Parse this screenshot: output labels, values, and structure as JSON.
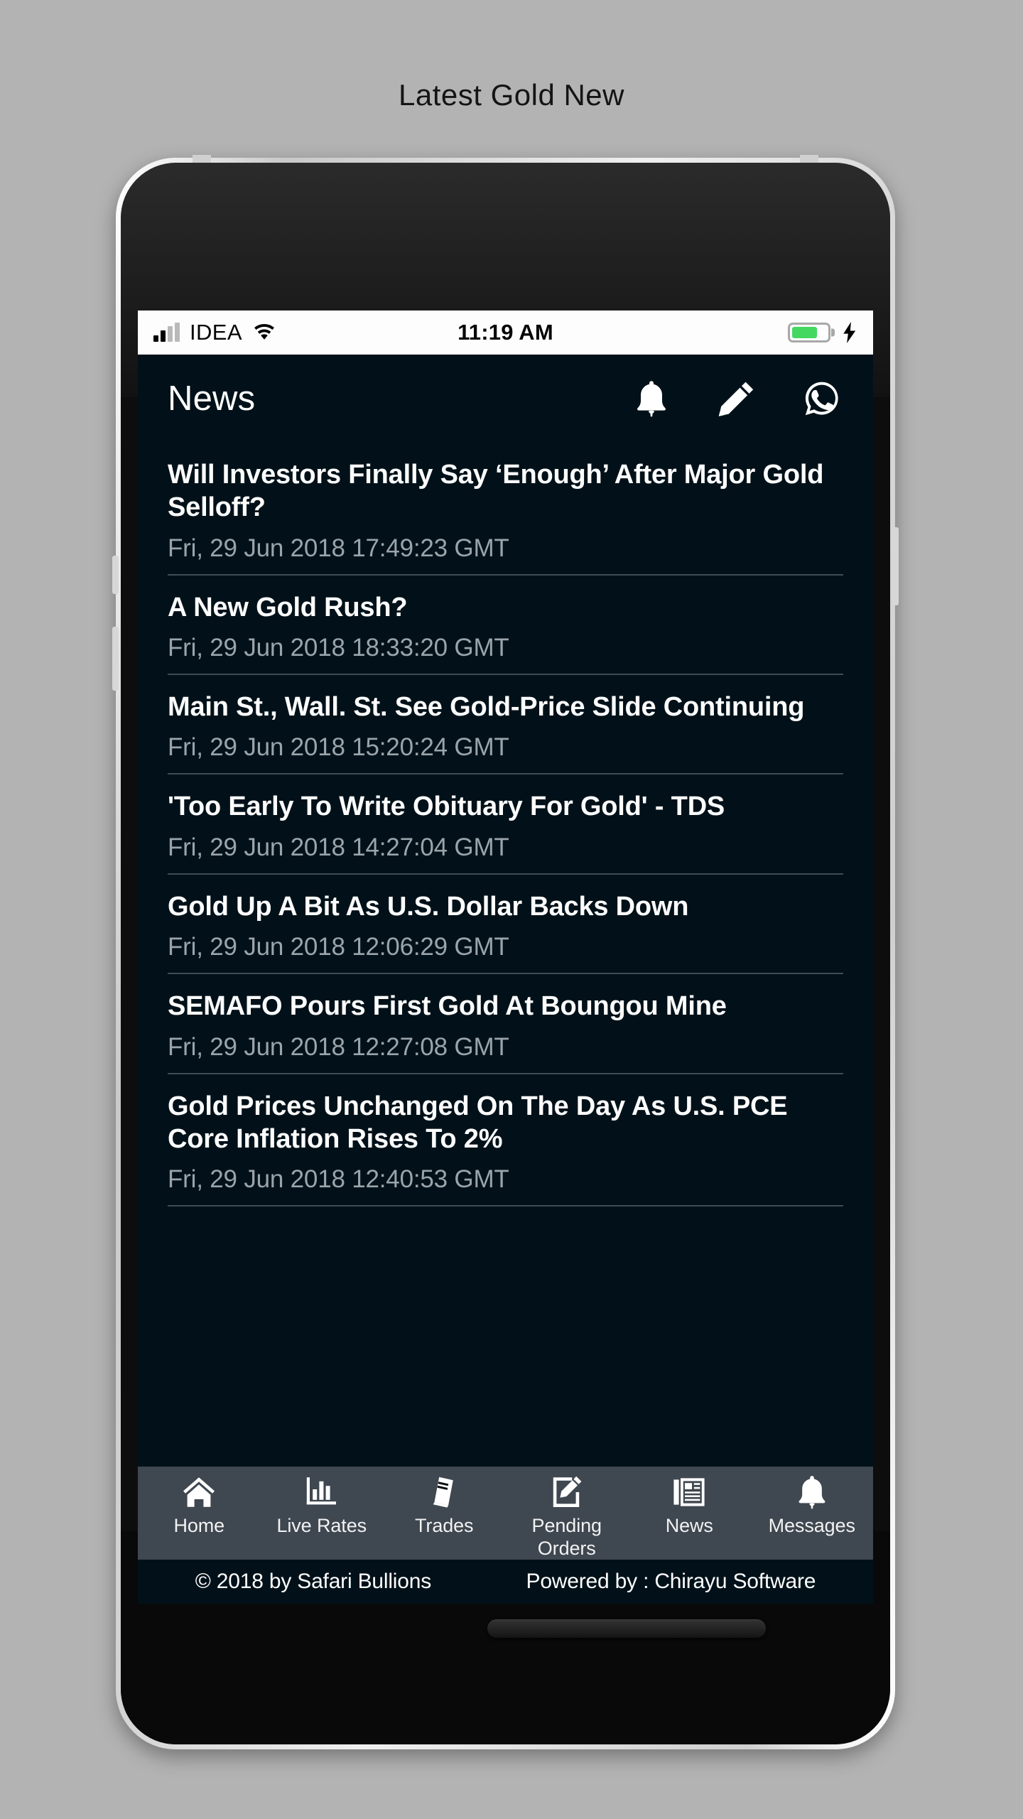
{
  "caption": "Latest Gold New",
  "status_bar": {
    "carrier": "IDEA",
    "time": "11:19 AM",
    "signal_icon": "signal-bars-icon",
    "wifi_icon": "wifi-icon",
    "battery_icon": "battery-icon",
    "battery_level_percent": 72,
    "battery_color": "#44d861",
    "charging_icon": "lightning-bolt-icon"
  },
  "header": {
    "title": "News",
    "actions": [
      {
        "name": "bell-icon",
        "label": "Notifications"
      },
      {
        "name": "pencil-icon",
        "label": "Compose"
      },
      {
        "name": "whatsapp-icon",
        "label": "WhatsApp"
      }
    ]
  },
  "news": {
    "items": [
      {
        "title": "Will Investors Finally Say ‘Enough’ After Major Gold Selloff?",
        "date": "Fri, 29 Jun 2018 17:49:23 GMT"
      },
      {
        "title": "A New Gold Rush?",
        "date": "Fri, 29 Jun 2018 18:33:20 GMT"
      },
      {
        "title": "Main St., Wall. St. See Gold-Price Slide Continuing",
        "date": "Fri, 29 Jun 2018 15:20:24 GMT"
      },
      {
        "title": "'Too Early To Write Obituary For Gold' - TDS",
        "date": "Fri, 29 Jun 2018 14:27:04 GMT"
      },
      {
        "title": "Gold Up A Bit As U.S. Dollar Backs Down",
        "date": "Fri, 29 Jun 2018 12:06:29 GMT"
      },
      {
        "title": "SEMAFO Pours First Gold At Boungou Mine",
        "date": "Fri, 29 Jun 2018 12:27:08 GMT"
      },
      {
        "title": "Gold Prices Unchanged On The Day As U.S. PCE Core Inflation Rises To 2%",
        "date": "Fri, 29 Jun 2018 12:40:53 GMT"
      }
    ]
  },
  "tab_bar": {
    "active": "News",
    "items": [
      {
        "label": "Home",
        "icon": "home-icon"
      },
      {
        "label": "Live Rates",
        "icon": "bar-chart-icon"
      },
      {
        "label": "Trades",
        "icon": "books-icon"
      },
      {
        "label": "Pending Orders",
        "icon": "note-edit-icon"
      },
      {
        "label": "News",
        "icon": "newspaper-icon"
      },
      {
        "label": "Messages",
        "icon": "bell-icon"
      }
    ]
  },
  "footer": {
    "copyright": "© 2018 by Safari Bullions",
    "powered_by": "Powered by : Chirayu Software"
  },
  "colors": {
    "screen_background": "#021119",
    "tab_bar_background": "#3f4750",
    "divider": "#3f4c55",
    "title_text": "#fdfdfd",
    "date_text": "#9aa4ab",
    "page_background": "#b3b3b3"
  }
}
